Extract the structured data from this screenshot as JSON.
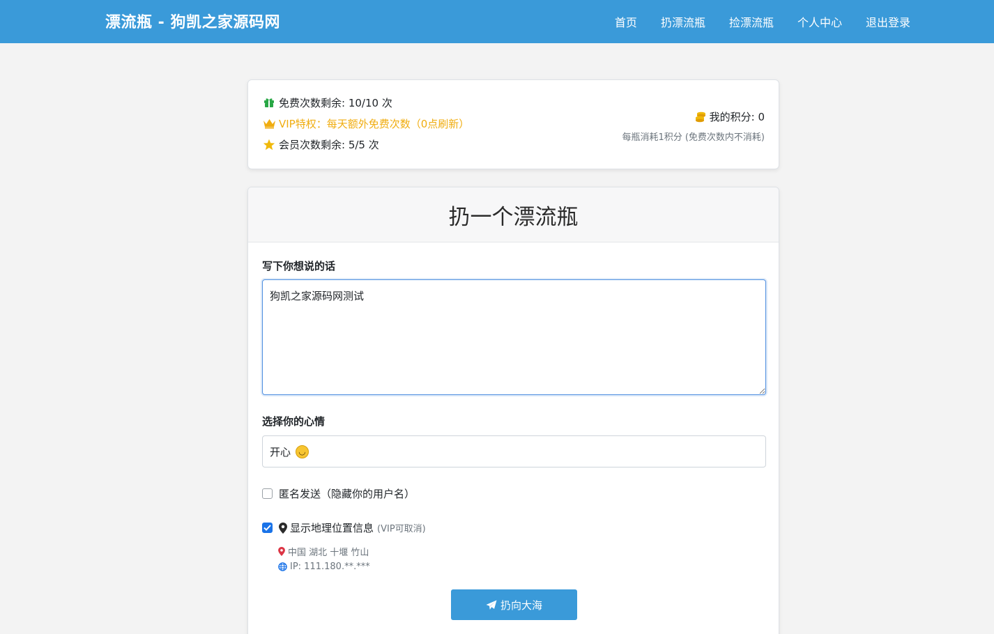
{
  "navbar": {
    "brand": "漂流瓶 - 狗凯之家源码网",
    "links": [
      "首页",
      "扔漂流瓶",
      "捡漂流瓶",
      "个人中心",
      "退出登录"
    ]
  },
  "quota": {
    "free_text": "免费次数剩余: 10/10 次",
    "vip_text": "VIP特权：每天额外免费次数（0点刷新）",
    "member_text": "会员次数剩余: 5/5 次",
    "points_text": "我的积分: 0",
    "points_note": "每瓶消耗1积分 (免费次数内不消耗)"
  },
  "form": {
    "title": "扔一个漂流瓶",
    "message_label": "写下你想说的话",
    "message_value": "狗凯之家源码网测试",
    "mood_label": "选择你的心情",
    "mood_value": "开心",
    "anonymous_label": "匿名发送（隐藏你的用户名）",
    "anonymous_checked": false,
    "location_label": "显示地理位置信息",
    "location_note": "(VIP可取消)",
    "location_checked": true,
    "location_place": "中国 湖北 十堰 竹山",
    "location_ip": "IP: 111.180.**.***",
    "submit_label": "扔向大海"
  },
  "colors": {
    "primary": "#3a9ad9",
    "vip": "#f0ad10",
    "checkbox": "#1a73e8",
    "pin_red": "#dc3545",
    "globe_blue": "#1a73e8"
  },
  "icons": {
    "free": "gift-icon",
    "vip": "crown-icon",
    "member": "star-icon",
    "points": "coins-icon",
    "location": "map-marker-icon",
    "place": "map-pin-icon",
    "ip": "globe-icon",
    "submit": "paper-plane-icon",
    "mood": "smiley-icon"
  }
}
